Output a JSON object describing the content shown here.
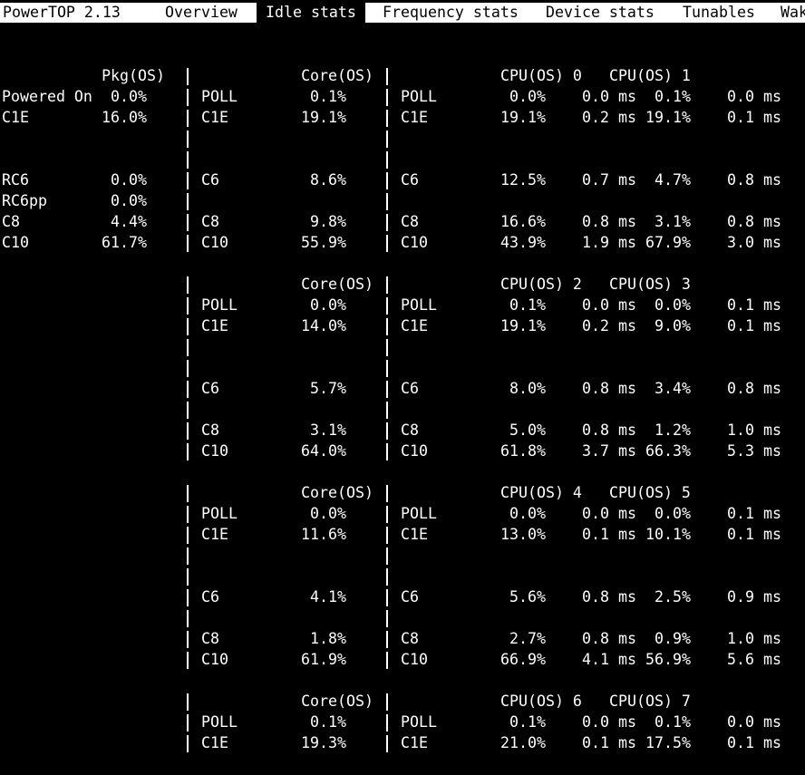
{
  "menu": {
    "title": "PowerTOP 2.13",
    "tabs": [
      "Overview",
      "Idle stats",
      "Frequency stats",
      "Device stats",
      "Tunables",
      "Wak"
    ],
    "active_tab": "Idle stats"
  },
  "pkg": {
    "header": "Pkg(OS)",
    "rows": [
      {
        "label": "Powered On",
        "value": "0.0%"
      },
      {
        "label": "C1E",
        "value": "16.0%"
      },
      {
        "label": "",
        "value": ""
      },
      {
        "label": "",
        "value": ""
      },
      {
        "label": "RC6",
        "value": "0.0%"
      },
      {
        "label": "RC6pp",
        "value": "0.0%"
      },
      {
        "label": "C8",
        "value": "4.4%"
      },
      {
        "label": "C10",
        "value": "61.7%"
      }
    ]
  },
  "blocks": [
    {
      "core_header": "Core(OS)",
      "cpu_a": "CPU(OS) 0",
      "cpu_b": "CPU(OS) 1",
      "rows": [
        {
          "state": "POLL",
          "core": "0.1%",
          "a_pct": "0.0%",
          "a_ms": "0.0 ms",
          "b_pct": "0.1%",
          "b_ms": "0.0 ms"
        },
        {
          "state": "C1E",
          "core": "19.1%",
          "a_pct": "19.1%",
          "a_ms": "0.2 ms",
          "b_pct": "19.1%",
          "b_ms": "0.1 ms"
        },
        {
          "state": "",
          "core": "",
          "a_pct": "",
          "a_ms": "",
          "b_pct": "",
          "b_ms": ""
        },
        {
          "state": "",
          "core": "",
          "a_pct": "",
          "a_ms": "",
          "b_pct": "",
          "b_ms": ""
        },
        {
          "state": "C6",
          "core": "8.6%",
          "a_pct": "12.5%",
          "a_ms": "0.7 ms",
          "b_pct": "4.7%",
          "b_ms": "0.8 ms"
        },
        {
          "state": "",
          "core": "",
          "a_pct": "",
          "a_ms": "",
          "b_pct": "",
          "b_ms": ""
        },
        {
          "state": "C8",
          "core": "9.8%",
          "a_pct": "16.6%",
          "a_ms": "0.8 ms",
          "b_pct": "3.1%",
          "b_ms": "0.8 ms"
        },
        {
          "state": "C10",
          "core": "55.9%",
          "a_pct": "43.9%",
          "a_ms": "1.9 ms",
          "b_pct": "67.9%",
          "b_ms": "3.0 ms"
        }
      ]
    },
    {
      "core_header": "Core(OS)",
      "cpu_a": "CPU(OS) 2",
      "cpu_b": "CPU(OS) 3",
      "rows": [
        {
          "state": "POLL",
          "core": "0.0%",
          "a_pct": "0.1%",
          "a_ms": "0.0 ms",
          "b_pct": "0.0%",
          "b_ms": "0.1 ms"
        },
        {
          "state": "C1E",
          "core": "14.0%",
          "a_pct": "19.1%",
          "a_ms": "0.2 ms",
          "b_pct": "9.0%",
          "b_ms": "0.1 ms"
        },
        {
          "state": "",
          "core": "",
          "a_pct": "",
          "a_ms": "",
          "b_pct": "",
          "b_ms": ""
        },
        {
          "state": "",
          "core": "",
          "a_pct": "",
          "a_ms": "",
          "b_pct": "",
          "b_ms": ""
        },
        {
          "state": "C6",
          "core": "5.7%",
          "a_pct": "8.0%",
          "a_ms": "0.8 ms",
          "b_pct": "3.4%",
          "b_ms": "0.8 ms"
        },
        {
          "state": "",
          "core": "",
          "a_pct": "",
          "a_ms": "",
          "b_pct": "",
          "b_ms": ""
        },
        {
          "state": "C8",
          "core": "3.1%",
          "a_pct": "5.0%",
          "a_ms": "0.8 ms",
          "b_pct": "1.2%",
          "b_ms": "1.0 ms"
        },
        {
          "state": "C10",
          "core": "64.0%",
          "a_pct": "61.8%",
          "a_ms": "3.7 ms",
          "b_pct": "66.3%",
          "b_ms": "5.3 ms"
        }
      ]
    },
    {
      "core_header": "Core(OS)",
      "cpu_a": "CPU(OS) 4",
      "cpu_b": "CPU(OS) 5",
      "rows": [
        {
          "state": "POLL",
          "core": "0.0%",
          "a_pct": "0.0%",
          "a_ms": "0.0 ms",
          "b_pct": "0.0%",
          "b_ms": "0.1 ms"
        },
        {
          "state": "C1E",
          "core": "11.6%",
          "a_pct": "13.0%",
          "a_ms": "0.1 ms",
          "b_pct": "10.1%",
          "b_ms": "0.1 ms"
        },
        {
          "state": "",
          "core": "",
          "a_pct": "",
          "a_ms": "",
          "b_pct": "",
          "b_ms": ""
        },
        {
          "state": "",
          "core": "",
          "a_pct": "",
          "a_ms": "",
          "b_pct": "",
          "b_ms": ""
        },
        {
          "state": "C6",
          "core": "4.1%",
          "a_pct": "5.6%",
          "a_ms": "0.8 ms",
          "b_pct": "2.5%",
          "b_ms": "0.9 ms"
        },
        {
          "state": "",
          "core": "",
          "a_pct": "",
          "a_ms": "",
          "b_pct": "",
          "b_ms": ""
        },
        {
          "state": "C8",
          "core": "1.8%",
          "a_pct": "2.7%",
          "a_ms": "0.8 ms",
          "b_pct": "0.9%",
          "b_ms": "1.0 ms"
        },
        {
          "state": "C10",
          "core": "61.9%",
          "a_pct": "66.9%",
          "a_ms": "4.1 ms",
          "b_pct": "56.9%",
          "b_ms": "5.6 ms"
        }
      ]
    },
    {
      "core_header": "Core(OS)",
      "cpu_a": "CPU(OS) 6",
      "cpu_b": "CPU(OS) 7",
      "rows": [
        {
          "state": "POLL",
          "core": "0.1%",
          "a_pct": "0.1%",
          "a_ms": "0.0 ms",
          "b_pct": "0.1%",
          "b_ms": "0.0 ms"
        },
        {
          "state": "C1E",
          "core": "19.3%",
          "a_pct": "21.0%",
          "a_ms": "0.1 ms",
          "b_pct": "17.5%",
          "b_ms": "0.1 ms"
        }
      ]
    }
  ]
}
